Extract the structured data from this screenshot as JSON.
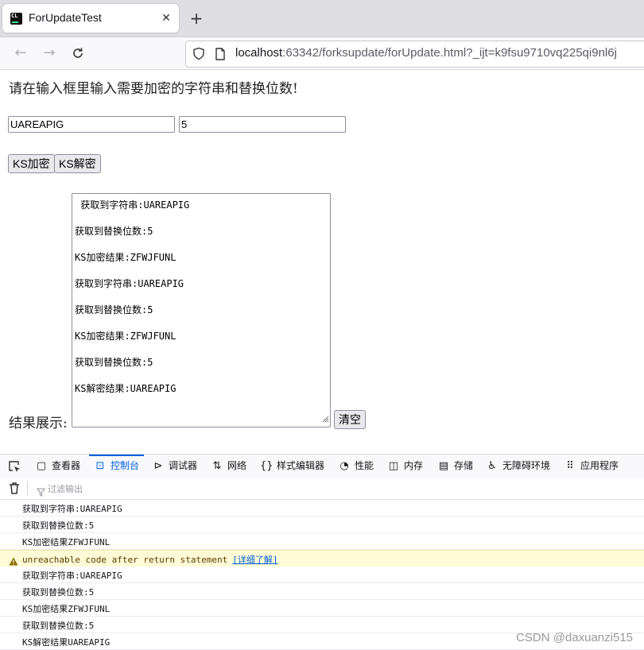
{
  "browser": {
    "tab_title": "ForUpdateTest",
    "tab_icon_text": "CL",
    "url_host": "localhost",
    "url_rest": ":63342/forksupdate/forUpdate.html?_ijt=k9fsu9710vq225qi9nl6j"
  },
  "page": {
    "heading": "请在输入框里输入需要加密的字符串和替换位数!",
    "input_text_value": "UAREAPIG",
    "input_shift_value": "5",
    "encrypt_button": "KS加密",
    "decrypt_button": "KS解密",
    "result_label": "结果展示:",
    "clear_button": "清空",
    "result_lines": [
      " 获取到字符串:UAREAPIG",
      "获取到替换位数:5",
      "KS加密结果:ZFWJFUNL",
      "获取到字符串:UAREAPIG",
      "获取到替换位数:5",
      "KS加密结果:ZFWJFUNL",
      "获取到替换位数:5",
      "KS解密结果:UAREAPIG"
    ]
  },
  "devtools": {
    "tabs": [
      "查看器",
      "控制台",
      "调试器",
      "网络",
      "样式编辑器",
      "性能",
      "内存",
      "存储",
      "无障碍环境",
      "应用程序"
    ],
    "active_tab": "控制台",
    "filter_placeholder": "过滤输出",
    "console_lines": [
      {
        "text": "获取到字符串:UAREAPIG",
        "level": "log"
      },
      {
        "text": "获取到替换位数:5",
        "level": "log"
      },
      {
        "text": "KS加密结果ZFWJFUNL",
        "level": "log"
      },
      {
        "text": "unreachable code after return statement",
        "level": "warn",
        "link": "[详细了解]"
      },
      {
        "text": "获取到字符串:UAREAPIG",
        "level": "log"
      },
      {
        "text": "获取到替换位数:5",
        "level": "log"
      },
      {
        "text": "KS加密结果ZFWJFUNL",
        "level": "log"
      },
      {
        "text": "获取到替换位数:5",
        "level": "log"
      },
      {
        "text": "KS解密结果UAREAPIG",
        "level": "log"
      }
    ]
  },
  "watermark": "CSDN @daxuanzi515",
  "colors": {
    "accent": "#0060df",
    "warning_bg": "#fffbd6"
  }
}
